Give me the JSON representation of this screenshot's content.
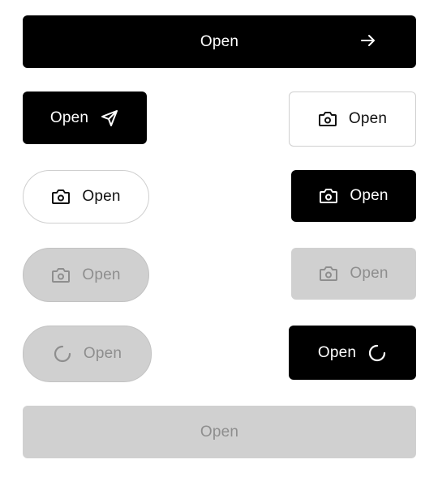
{
  "buttons": {
    "primary_wide": {
      "label": "Open",
      "icon": "arrow-right-icon"
    },
    "dark_send": {
      "label": "Open",
      "icon": "send-icon"
    },
    "outline_camera": {
      "label": "Open",
      "icon": "camera-icon"
    },
    "pill_outline_camera": {
      "label": "Open",
      "icon": "camera-icon"
    },
    "dark_camera": {
      "label": "Open",
      "icon": "camera-icon"
    },
    "pill_disabled_camera": {
      "label": "Open",
      "icon": "camera-icon"
    },
    "disabled_camera": {
      "label": "Open",
      "icon": "camera-icon"
    },
    "pill_loading": {
      "label": "Open",
      "icon": "spinner-icon"
    },
    "dark_loading": {
      "label": "Open",
      "icon": "spinner-icon"
    },
    "disabled_wide": {
      "label": "Open"
    }
  },
  "colors": {
    "dark": "#000000",
    "disabled_bg": "#d0d0d0",
    "disabled_text": "#8e8e8e",
    "outline_border": "#cfcfcf"
  }
}
